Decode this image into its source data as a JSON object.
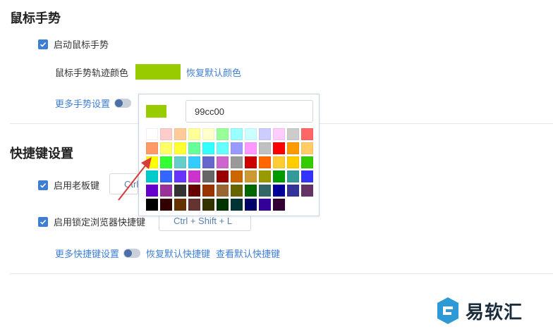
{
  "mouse_gesture": {
    "title": "鼠标手势",
    "enable_label": "启动鼠标手势",
    "trail_color_label": "鼠标手势轨迹颜色",
    "trail_color": "#99cc00",
    "restore_color_link": "恢复默认颜色",
    "more_settings_link": "更多手势设置"
  },
  "color_picker": {
    "hex_value": "99cc00",
    "current_color": "#99cc00",
    "palette": [
      "#ffffff",
      "#ffcccc",
      "#ffcc99",
      "#ffff99",
      "#ffffcc",
      "#99ff99",
      "#99ffff",
      "#ccffff",
      "#ccccff",
      "#ffccff",
      "#cccccc",
      "#ff6666",
      "#ff9966",
      "#ffff66",
      "#ffff33",
      "#66ff99",
      "#33ffff",
      "#66ffff",
      "#9999ff",
      "#ff99ff",
      "#c0c0c0",
      "#ff0000",
      "#ff9900",
      "#ffcc66",
      "#ffff00",
      "#33ff33",
      "#66cccc",
      "#33ccff",
      "#6666cc",
      "#cc66cc",
      "#999999",
      "#cc0000",
      "#ff6600",
      "#ffcc33",
      "#ffcc00",
      "#33cc00",
      "#00cccc",
      "#3366ff",
      "#6633ff",
      "#cc33cc",
      "#666666",
      "#990000",
      "#cc6600",
      "#cc9933",
      "#999900",
      "#009900",
      "#339999",
      "#3333ff",
      "#6600cc",
      "#993399",
      "#333333",
      "#660000",
      "#993300",
      "#996633",
      "#666600",
      "#006600",
      "#336666",
      "#000099",
      "#333399",
      "#663366",
      "#000000",
      "#330000",
      "#663300",
      "#663333",
      "#333300",
      "#003300",
      "#003333",
      "#000066",
      "#330099",
      "#330033"
    ]
  },
  "shortcuts": {
    "title": "快捷键设置",
    "boss_key_label": "启用老板键",
    "boss_key_value": "Ctrl",
    "lock_browser_label": "启用锁定浏览器快捷键",
    "lock_browser_value": "Ctrl + Shift + L",
    "more_settings_link": "更多快捷键设置",
    "restore_link": "恢复默认快捷键",
    "view_default_link": "查看默认快捷键"
  },
  "watermark": {
    "text": "易软汇"
  }
}
